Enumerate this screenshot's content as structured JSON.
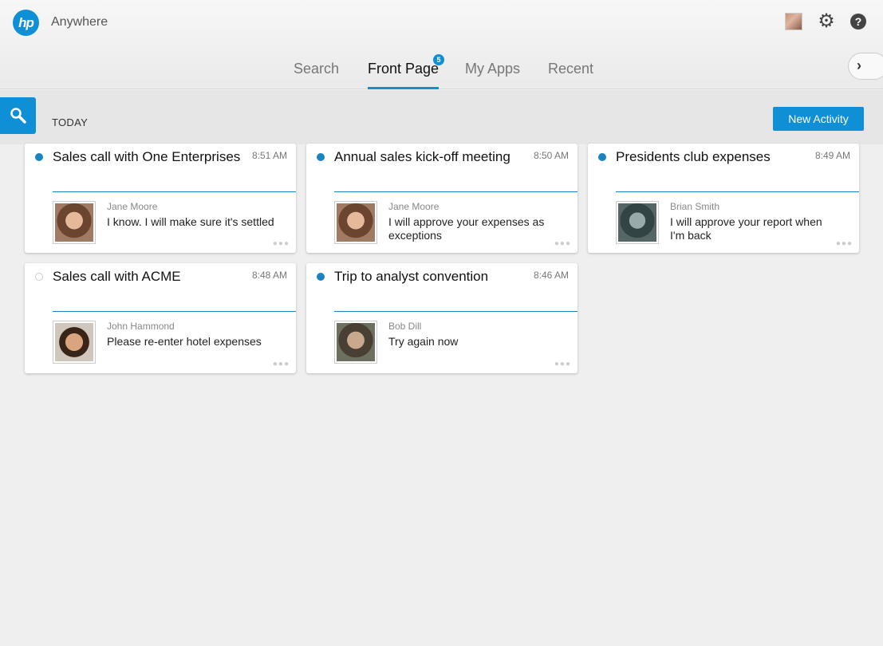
{
  "header": {
    "logo_text": "hp",
    "app_title": "Anywhere"
  },
  "tabs": [
    {
      "label": "Search"
    },
    {
      "label": "Front Page",
      "badge": "5"
    },
    {
      "label": "My Apps"
    },
    {
      "label": "Recent"
    }
  ],
  "toolbar": {
    "section_label": "TODAY",
    "new_activity_label": "New Activity"
  },
  "cards": [
    {
      "title": "Sales call with One Enterprises",
      "time": "8:51 AM",
      "author": "Jane Moore",
      "message": "I know. I will make sure it's settled",
      "unread": true
    },
    {
      "title": "Annual sales kick-off meeting",
      "time": "8:50 AM",
      "author": "Jane Moore",
      "message": "I will approve your expenses as exceptions",
      "unread": true
    },
    {
      "title": "Presidents club expenses",
      "time": "8:49 AM",
      "author": "Brian Smith",
      "message": "I will approve your report when I'm back",
      "unread": true
    },
    {
      "title": "Sales call with ACME",
      "time": "8:48 AM",
      "author": "John Hammond",
      "message": "Please re-enter hotel expenses",
      "unread": false
    },
    {
      "title": "Trip to analyst convention",
      "time": "8:46 AM",
      "author": "Bob Dill",
      "message": "Try again now",
      "unread": true
    }
  ],
  "icons": {
    "settings": "gear-icon",
    "help": "help-icon",
    "search": "search-icon",
    "next": "chevron-right-icon"
  },
  "colors": {
    "accent": "#0e8fd6",
    "unread_dot": "#1a84c2"
  }
}
